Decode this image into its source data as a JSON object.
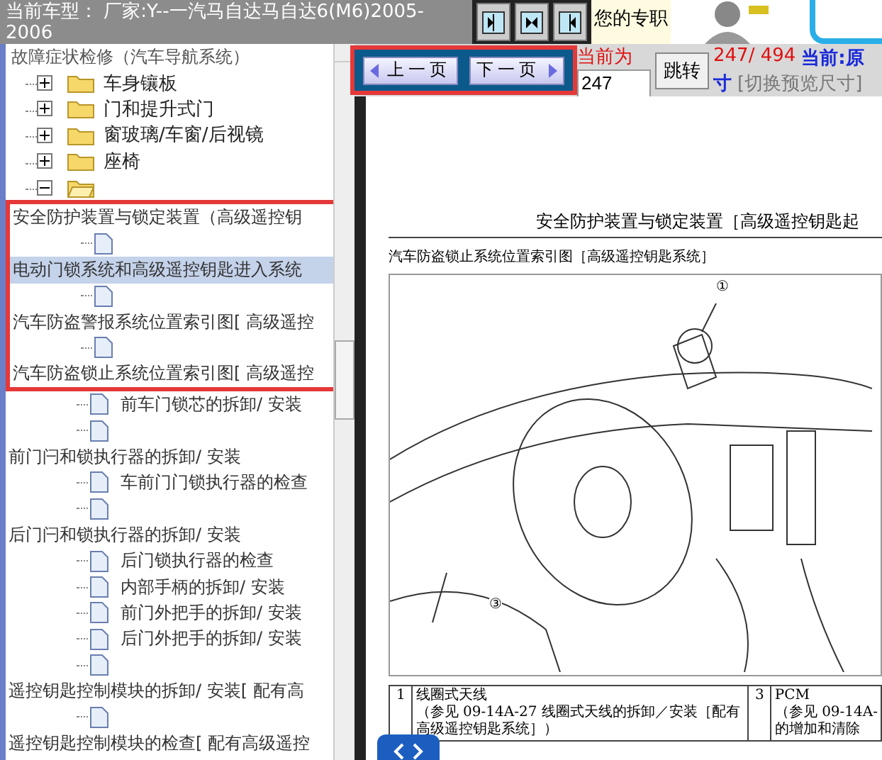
{
  "header": {
    "vehicle": "当前车型： 厂家:Y--一汽马自达马自达6(M6)2005-2006",
    "promo": "您的专职"
  },
  "view_buttons": [
    {
      "kind": "right"
    },
    {
      "kind": "both"
    },
    {
      "kind": "left"
    }
  ],
  "tree": {
    "items": [
      {
        "kind": "heading",
        "label": "故障症状检修（汽车导航系统）"
      },
      {
        "kind": "folder",
        "label": "车身镶板",
        "expanded": false
      },
      {
        "kind": "folder",
        "label": "门和提升式门",
        "expanded": false
      },
      {
        "kind": "folder",
        "label": "窗玻璃/车窗/后视镜",
        "expanded": false
      },
      {
        "kind": "folder",
        "label": "座椅",
        "expanded": false
      },
      {
        "kind": "folder",
        "expanded": true,
        "children": [
          {
            "kind": "label",
            "label": "安全防护装置与锁定装置（高级遥控钥",
            "selected": false,
            "framed": true
          },
          {
            "kind": "doc",
            "selected": false,
            "framed": true
          },
          {
            "kind": "label",
            "label": "电动门锁系统和高级遥控钥匙进入系统",
            "selected": true,
            "framed": true
          },
          {
            "kind": "doc",
            "selected": false,
            "framed": true
          },
          {
            "kind": "label",
            "label": "汽车防盗警报系统位置索引图[ 高级遥控",
            "selected": false,
            "framed": true
          },
          {
            "kind": "doc",
            "selected": false,
            "framed": true
          },
          {
            "kind": "label",
            "label": "汽车防盗锁止系统位置索引图[ 高级遥控",
            "selected": false,
            "framed": true
          },
          {
            "kind": "doc",
            "label": "前车门锁芯的拆卸/ 安装",
            "selected": false,
            "framed": false
          },
          {
            "kind": "doc",
            "selected": false,
            "framed": false
          },
          {
            "kind": "label",
            "label": "前门闩和锁执行器的拆卸/ 安装",
            "selected": false,
            "framed": false
          },
          {
            "kind": "doc",
            "label": "车前门门锁执行器的检查",
            "selected": false,
            "framed": false
          },
          {
            "kind": "doc",
            "selected": false,
            "framed": false
          },
          {
            "kind": "label",
            "label": "后门闩和锁执行器的拆卸/ 安装",
            "selected": false,
            "framed": false
          },
          {
            "kind": "doc",
            "label": "后门锁执行器的检查",
            "selected": false,
            "framed": false
          },
          {
            "kind": "doc",
            "label": "内部手柄的拆卸/ 安装",
            "selected": false,
            "framed": false
          },
          {
            "kind": "doc",
            "label": "前门外把手的拆卸/ 安装",
            "selected": false,
            "framed": false
          },
          {
            "kind": "doc",
            "label": "后门外把手的拆卸/ 安装",
            "selected": false,
            "framed": false
          },
          {
            "kind": "doc",
            "selected": false,
            "framed": false
          },
          {
            "kind": "label",
            "label": "遥控钥匙控制模块的拆卸/ 安装[ 配有高",
            "selected": false,
            "framed": false
          },
          {
            "kind": "doc",
            "selected": false,
            "framed": false
          },
          {
            "kind": "label",
            "label": "遥控钥匙控制模块的检查[ 配有高级遥控",
            "selected": false,
            "framed": false
          }
        ]
      }
    ]
  },
  "toolbar": {
    "framed": true,
    "prev": "上一页",
    "next": "下一页",
    "page_label": "当前为",
    "page_input": "247",
    "jump": "跳转",
    "page_count": "247/ 494",
    "view_mode": "当前:原",
    "view_mode_cont": "寸",
    "switch_size": "[切换预览尺寸]"
  },
  "document": {
    "title": "安全防护装置与锁定装置［高级遥控钥匙起",
    "subtitle": "汽车防盗锁止系统位置索引图［高级遥控钥匙系统］",
    "callouts": [
      "①",
      "③"
    ],
    "table": {
      "rows": [
        {
          "cells": [
            {
              "lines": [
                "1"
              ]
            },
            {
              "lines": [
                "线圈式天线",
                "（参见 09-14A-27 线圈式天线的拆卸／安装［配有",
                "高级遥控钥匙系统］）"
              ]
            },
            {
              "lines": [
                "3"
              ]
            },
            {
              "lines": [
                "PCM",
                "（参见 09-14A-",
                "的增加和清除"
              ]
            }
          ]
        }
      ]
    }
  }
}
